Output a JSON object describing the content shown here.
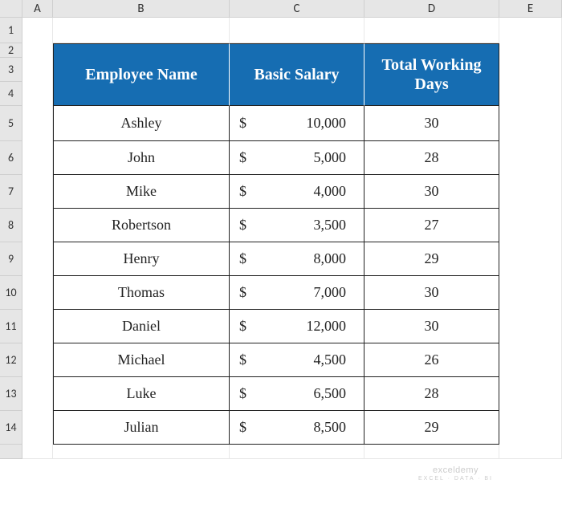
{
  "columns": [
    "A",
    "B",
    "C",
    "D",
    "E"
  ],
  "row_numbers": [
    "1",
    "2",
    "3",
    "4",
    "5",
    "6",
    "7",
    "8",
    "9",
    "10",
    "11",
    "12",
    "13",
    "14"
  ],
  "headers": {
    "name": "Employee Name",
    "salary": "Basic Salary",
    "days": "Total Working Days"
  },
  "currency_symbol": "$",
  "data": [
    {
      "name": "Ashley",
      "salary": "10,000",
      "days": "30"
    },
    {
      "name": "John",
      "salary": "5,000",
      "days": "28"
    },
    {
      "name": "Mike",
      "salary": "4,000",
      "days": "30"
    },
    {
      "name": "Robertson",
      "salary": "3,500",
      "days": "27"
    },
    {
      "name": "Henry",
      "salary": "8,000",
      "days": "29"
    },
    {
      "name": "Thomas",
      "salary": "7,000",
      "days": "30"
    },
    {
      "name": "Daniel",
      "salary": "12,000",
      "days": "30"
    },
    {
      "name": "Michael",
      "salary": "4,500",
      "days": "26"
    },
    {
      "name": "Luke",
      "salary": "6,500",
      "days": "28"
    },
    {
      "name": "Julian",
      "salary": "8,500",
      "days": "29"
    }
  ],
  "watermark": {
    "main": "exceldemy",
    "sub": "EXCEL · DATA · BI"
  }
}
